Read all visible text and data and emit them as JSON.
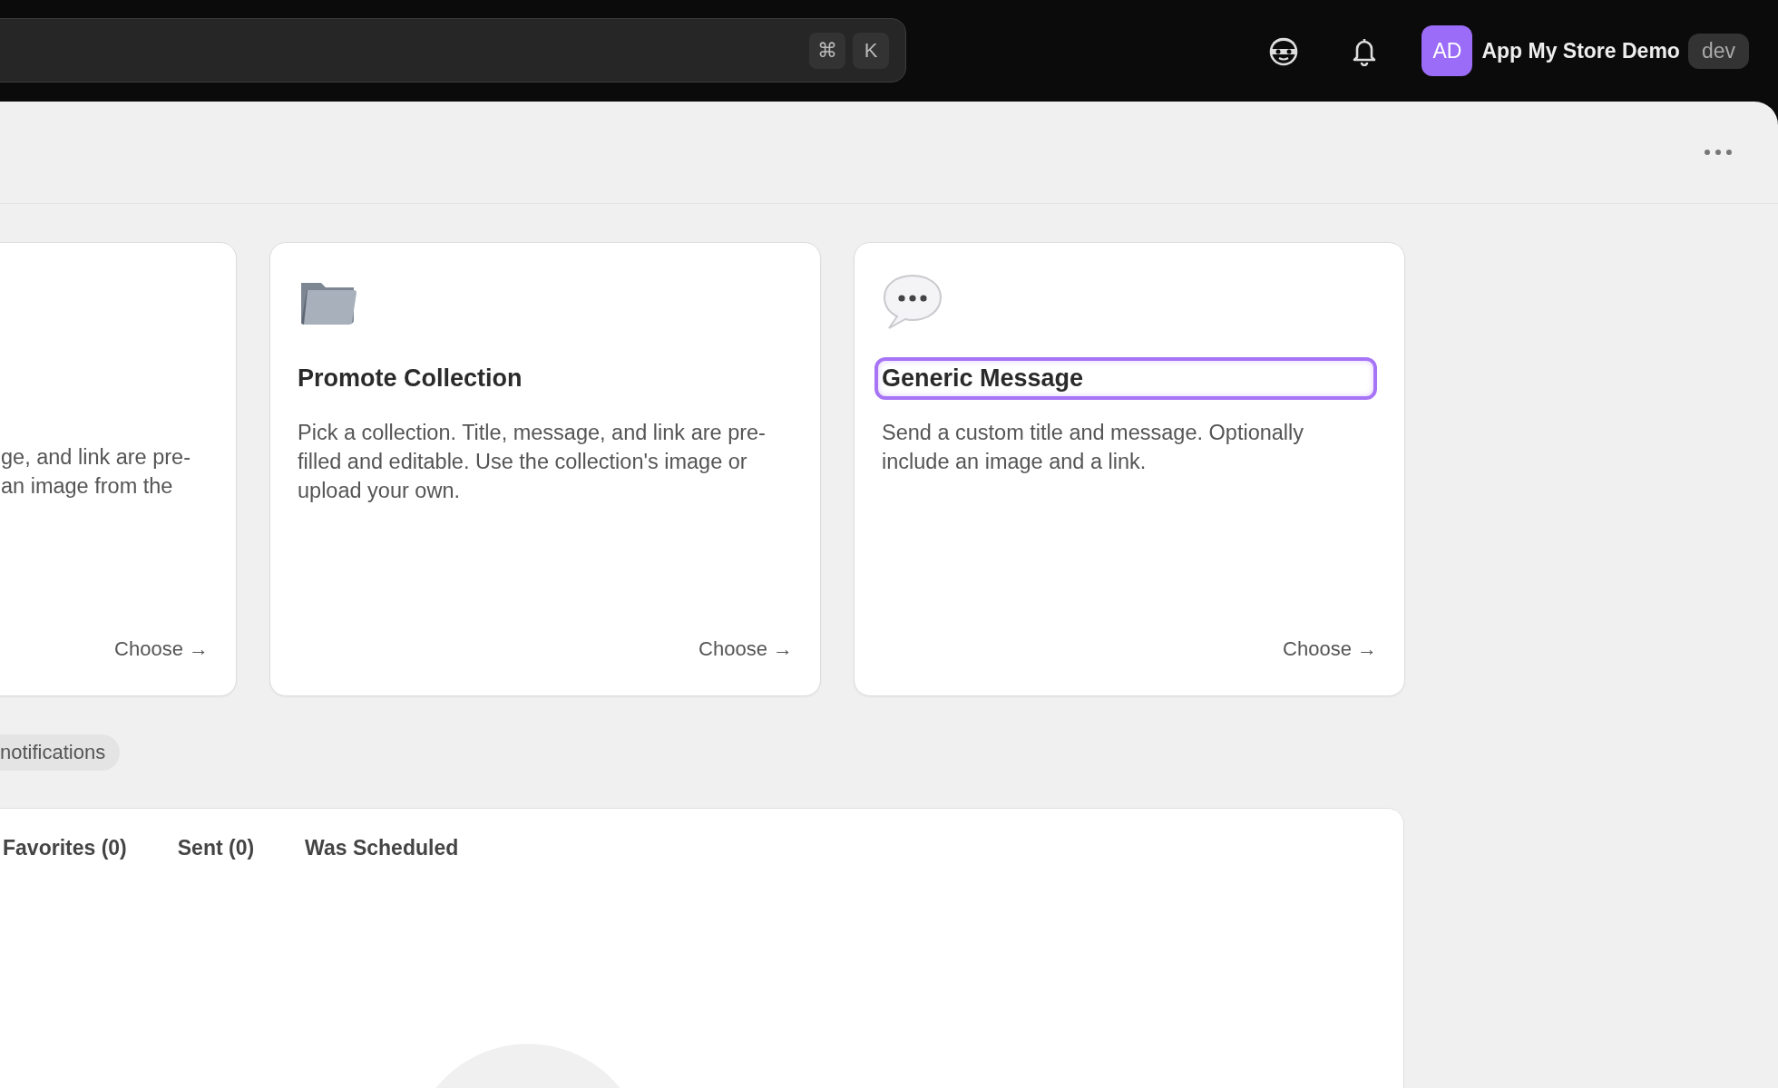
{
  "search": {
    "shortcut_keys": [
      "⌘",
      "K"
    ]
  },
  "user": {
    "initials": "AD",
    "name": "App My Store Demo",
    "badge": "dev"
  },
  "cards": [
    {
      "kind": "clipped",
      "description_lines": [
        "ge, and link are pre-",
        "an image from the"
      ],
      "action": "Choose →"
    },
    {
      "kind": "folder",
      "title": "Promote Collection",
      "description": "Pick a collection. Title, message, and link are pre-filled and editable. Use the collection's image or upload your own.",
      "action": "Choose →",
      "focused": false
    },
    {
      "kind": "message",
      "title": "Generic Message",
      "description": "Send a custom title and message. Optionally include an image and a link.",
      "action": "Choose →",
      "focused": true
    }
  ],
  "filter_chip": "notifications",
  "tabs": [
    {
      "label": "Favorites (0)",
      "selected": false
    },
    {
      "label": "Sent (0)",
      "selected": false
    },
    {
      "label": "Was Scheduled",
      "selected": false
    }
  ]
}
